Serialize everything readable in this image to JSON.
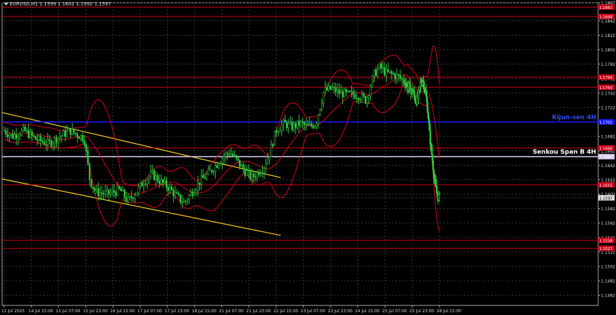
{
  "header": {
    "symbol_line": "EURUSD,H1  1.1599 1.1602 1.1592 1.1597"
  },
  "chart_data": {
    "type": "candlestick",
    "ylim": [
      1.1448,
      1.1867
    ],
    "y_ticks": [
      "1.1867",
      "1.1842",
      "1.1822",
      "1.1802",
      "1.1782",
      "1.1762",
      "1.1742",
      "1.1722",
      "1.1702",
      "1.1682",
      "1.1662",
      "1.1642",
      "1.1622",
      "1.1602",
      "1.1582",
      "1.1562",
      "1.1542",
      "1.1522",
      "1.1502",
      "1.1482",
      "1.1462"
    ],
    "x_ticks": [
      "11 Jul 2025",
      "14 Jul 15:00",
      "15 Jul 07:00",
      "15 Jul 23:00",
      "16 Jul 15:00",
      "17 Jul 07:00",
      "17 Jul 23:00",
      "18 Jul 15:00",
      "21 Jul 07:00",
      "21 Jul 23:00",
      "22 Jul 15:00",
      "23 Jul 07:00",
      "23 Jul 23:00",
      "24 Jul 15:00",
      "25 Jul 07:00",
      "25 Jul 23:00",
      "28 Jul 15:00"
    ],
    "current_price": "1.1597",
    "horizontal_levels": [
      {
        "value": 1.1861,
        "label": "1.1861",
        "color": "#d0021b"
      },
      {
        "value": 1.1848,
        "label": "1.1848",
        "color": "#d0021b"
      },
      {
        "value": 1.1764,
        "label": "1.1764",
        "color": "#d0021b"
      },
      {
        "value": 1.175,
        "label": "1.1750",
        "color": "#d0021b"
      },
      {
        "value": 1.1702,
        "label": "1.1702",
        "color": "#1818ff",
        "name": "Kijun-sen 4H"
      },
      {
        "value": 1.1666,
        "label": "1.1666",
        "color": "#d0021b"
      },
      {
        "value": 1.1654,
        "label": "1.1654",
        "color": "#d8c8e8",
        "name": "Senkou Span B 4H"
      },
      {
        "value": 1.1615,
        "label": "1.1615",
        "color": "#d0021b"
      },
      {
        "value": 1.1538,
        "label": "1.1538",
        "color": "#d0021b"
      },
      {
        "value": 1.1527,
        "label": "1.1527",
        "color": "#d0021b"
      }
    ],
    "channel": {
      "color": "#ffd21a",
      "upper": [
        [
          0,
          1.1715
        ],
        [
          1.0,
          1.1625
        ]
      ],
      "lower": [
        [
          0,
          1.1623
        ],
        [
          1.0,
          1.1545
        ]
      ]
    },
    "price_path": [
      [
        0.0,
        1.169
      ],
      [
        0.02,
        1.1682
      ],
      [
        0.05,
        1.169
      ],
      [
        0.08,
        1.1678
      ],
      [
        0.11,
        1.1672
      ],
      [
        0.14,
        1.1682
      ],
      [
        0.165,
        1.169
      ],
      [
        0.18,
        1.1685
      ],
      [
        0.2,
        1.168
      ],
      [
        0.215,
        1.162
      ],
      [
        0.23,
        1.1605
      ],
      [
        0.26,
        1.1602
      ],
      [
        0.29,
        1.1608
      ],
      [
        0.31,
        1.1592
      ],
      [
        0.33,
        1.1605
      ],
      [
        0.35,
        1.162
      ],
      [
        0.37,
        1.163
      ],
      [
        0.39,
        1.162
      ],
      [
        0.41,
        1.1612
      ],
      [
        0.43,
        1.16
      ],
      [
        0.45,
        1.159
      ],
      [
        0.47,
        1.1605
      ],
      [
        0.49,
        1.162
      ],
      [
        0.51,
        1.163
      ],
      [
        0.53,
        1.1642
      ],
      [
        0.55,
        1.1655
      ],
      [
        0.565,
        1.166
      ],
      [
        0.58,
        1.165
      ],
      [
        0.6,
        1.1635
      ],
      [
        0.62,
        1.1625
      ],
      [
        0.635,
        1.1632
      ],
      [
        0.65,
        1.164
      ],
      [
        0.665,
        1.166
      ],
      [
        0.68,
        1.169
      ],
      [
        0.7,
        1.17
      ],
      [
        0.72,
        1.1695
      ],
      [
        0.74,
        1.17
      ],
      [
        0.76,
        1.1695
      ],
      [
        0.78,
        1.17
      ],
      [
        0.8,
        1.1745
      ],
      [
        0.82,
        1.1748
      ],
      [
        0.84,
        1.1742
      ],
      [
        0.86,
        1.174
      ],
      [
        0.875,
        1.174
      ],
      [
        0.89,
        1.1738
      ],
      [
        0.905,
        1.1732
      ],
      [
        0.915,
        1.1748
      ],
      [
        0.925,
        1.1768
      ],
      [
        0.94,
        1.1778
      ],
      [
        0.955,
        1.177
      ],
      [
        0.97,
        1.1768
      ],
      [
        0.985,
        1.1765
      ],
      [
        1.0,
        1.1758
      ]
    ],
    "price_path_2": [
      [
        0.0,
        1.1758
      ],
      [
        0.03,
        1.175
      ],
      [
        0.06,
        1.1752
      ],
      [
        0.1,
        1.1745
      ],
      [
        0.14,
        1.1742
      ],
      [
        0.18,
        1.173
      ],
      [
        0.22,
        1.1738
      ],
      [
        0.26,
        1.1755
      ],
      [
        0.3,
        1.176
      ],
      [
        0.34,
        1.1745
      ],
      [
        0.38,
        1.172
      ],
      [
        0.42,
        1.168
      ],
      [
        0.46,
        1.165
      ],
      [
        0.5,
        1.162
      ],
      [
        0.54,
        1.16
      ],
      [
        0.58,
        1.1597
      ]
    ],
    "bollinger": {
      "color": "#e0001a"
    }
  }
}
